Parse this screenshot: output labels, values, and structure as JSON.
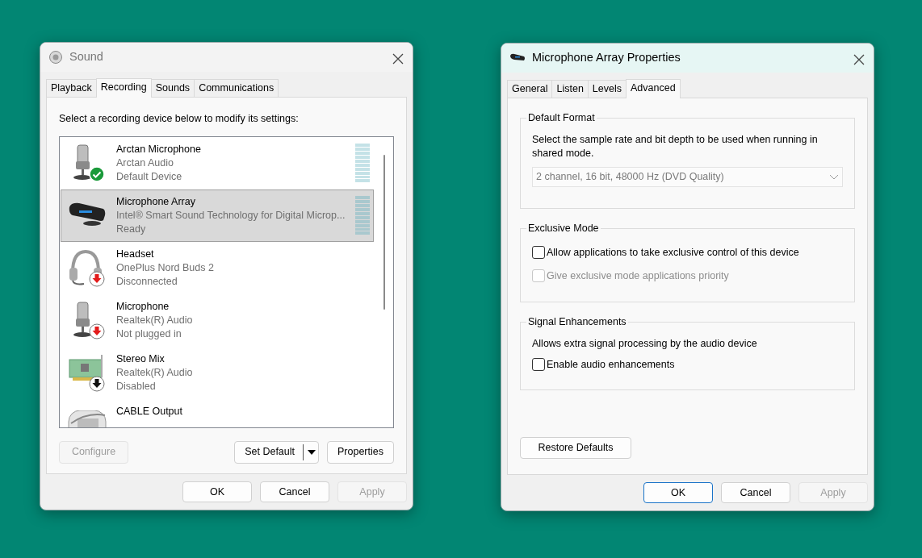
{
  "sound_window": {
    "title": "Sound",
    "active": false,
    "tabs": [
      {
        "label": "Playback",
        "selected": false
      },
      {
        "label": "Recording",
        "selected": true
      },
      {
        "label": "Sounds",
        "selected": false
      },
      {
        "label": "Communications",
        "selected": false
      }
    ],
    "instruction": "Select a recording device below to modify its settings:",
    "devices": [
      {
        "name": "Arctan Microphone",
        "manufacturer": "Arctan Audio",
        "status": "Default Device",
        "kind": "microphone_default",
        "selected": false,
        "meter": true
      },
      {
        "name": "Microphone Array",
        "manufacturer": "Intel® Smart Sound Technology for Digital Microp...",
        "status": "Ready",
        "kind": "webcam",
        "selected": true,
        "meter": true
      },
      {
        "name": "Headset",
        "manufacturer": "OnePlus Nord Buds 2",
        "status": "Disconnected",
        "kind": "headset_unplugged",
        "selected": false
      },
      {
        "name": "Microphone",
        "manufacturer": "Realtek(R) Audio",
        "status": "Not plugged in",
        "kind": "microphone_unplugged",
        "selected": false
      },
      {
        "name": "Stereo Mix",
        "manufacturer": "Realtek(R) Audio",
        "status": "Disabled",
        "kind": "card_disabled",
        "selected": false
      },
      {
        "name": "CABLE Output",
        "kind": "cable",
        "selected": false
      }
    ],
    "buttons": [
      {
        "label": "Configure",
        "disabled": true,
        "kind": "plain"
      },
      {
        "label": "Set Default",
        "disabled": false,
        "kind": "split"
      },
      {
        "label": "Properties",
        "disabled": false,
        "kind": "plain"
      }
    ],
    "footer_buttons": [
      {
        "label": "OK",
        "disabled": false,
        "default": false
      },
      {
        "label": "Cancel",
        "disabled": false,
        "default": false
      },
      {
        "label": "Apply",
        "disabled": true,
        "default": false
      }
    ]
  },
  "properties_window": {
    "title": "Microphone Array Properties",
    "active": true,
    "tabs": [
      {
        "label": "General",
        "selected": false
      },
      {
        "label": "Listen",
        "selected": false
      },
      {
        "label": "Levels",
        "selected": false
      },
      {
        "label": "Advanced",
        "selected": true
      }
    ],
    "groups": [
      {
        "title": "Default Format",
        "items": [
          {
            "kind": "text",
            "text": "Select the sample rate and bit depth to be used when running in shared mode."
          },
          {
            "kind": "select",
            "value": "2 channel, 16 bit, 48000 Hz (DVD Quality)",
            "disabled": true
          }
        ]
      },
      {
        "title": "Exclusive Mode",
        "items": [
          {
            "kind": "checkbox",
            "label": "Allow applications to take exclusive control of this device",
            "checked": false,
            "disabled": false
          },
          {
            "kind": "checkbox",
            "label": "Give exclusive mode applications priority",
            "checked": false,
            "disabled": true
          }
        ]
      },
      {
        "title": "Signal Enhancements",
        "items": [
          {
            "kind": "text",
            "text": "Allows extra signal processing by the audio device"
          },
          {
            "kind": "checkbox",
            "label": "Enable audio enhancements",
            "checked": false,
            "disabled": false
          }
        ]
      }
    ],
    "restore_button": "Restore Defaults",
    "footer_buttons": [
      {
        "label": "OK",
        "disabled": false,
        "default": true
      },
      {
        "label": "Cancel",
        "disabled": false,
        "default": false
      },
      {
        "label": "Apply",
        "disabled": true,
        "default": false
      }
    ]
  }
}
